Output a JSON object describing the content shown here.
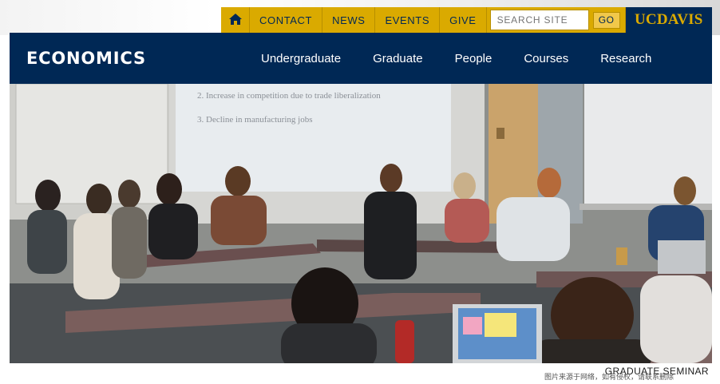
{
  "utility_bar": {
    "home_icon": "home-icon",
    "links": [
      "CONTACT",
      "NEWS",
      "EVENTS",
      "GIVE"
    ],
    "search_placeholder": "SEARCH SITE",
    "search_button": "GO",
    "logo_text": "UCDAVIS"
  },
  "header": {
    "brand": "ECONOMICS",
    "nav": [
      "Undergraduate",
      "Graduate",
      "People",
      "Courses",
      "Research"
    ]
  },
  "hero": {
    "slide_lines": [
      "2.  Increase in competition due to trade liberalization",
      "3.  Decline in manufacturing jobs"
    ],
    "caption": "GRADUATE SEMINAR",
    "watermark": "图片来源于网络，如有侵权，请联系删除"
  },
  "colors": {
    "navy": "#002855",
    "gold": "#daaa00"
  }
}
